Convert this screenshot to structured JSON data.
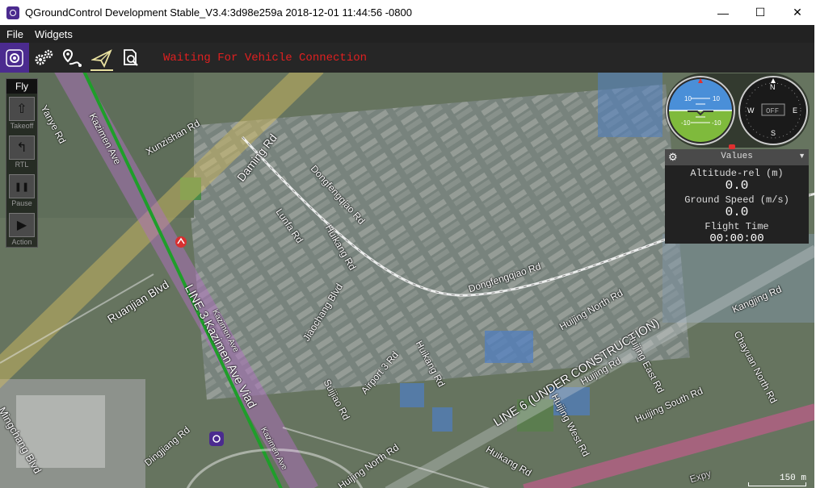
{
  "window": {
    "title": "QGroundControl Development Stable_V3.4:3d98e259a 2018-12-01 11:44:56 -0800",
    "controls": {
      "minimize": "—",
      "maximize": "☐",
      "close": "✕"
    }
  },
  "menu": {
    "items": [
      "File",
      "Widgets"
    ]
  },
  "toolbar": {
    "buttons": [
      "qgc-logo-icon",
      "settings-gears-icon",
      "plan-waypoint-icon",
      "fly-paper-plane-icon",
      "analyze-icon"
    ],
    "status": "Waiting For Vehicle Connection"
  },
  "fly_tools": {
    "title": "Fly",
    "items": [
      {
        "label": "Takeoff",
        "icon": "takeoff-icon",
        "glyph": "⇧"
      },
      {
        "label": "RTL",
        "icon": "rtl-icon",
        "glyph": "↰"
      },
      {
        "label": "Pause",
        "icon": "pause-icon",
        "glyph": "❚❚"
      },
      {
        "label": "Action",
        "icon": "action-icon",
        "glyph": "▶"
      }
    ]
  },
  "attitude": {
    "pitch_marks": [
      "10",
      "10",
      "-10",
      "-10"
    ]
  },
  "compass": {
    "n": "N",
    "e": "E",
    "s": "S",
    "w": "W",
    "status": "OFF"
  },
  "values": {
    "title": "Values",
    "altitude_label": "Altitude-rel (m)",
    "altitude_value": "0.0",
    "speed_label": "Ground Speed (m/s)",
    "speed_value": "0.0",
    "time_label": "Flight Time",
    "time_value": "00:00:00"
  },
  "map": {
    "roads": {
      "yanye": "Yanye Rd",
      "kazimen": "Kazimen Ave",
      "xunzishan": "Xunzishan Rd",
      "daming": "Daming Rd",
      "dongfengqiao1": "Dongfengqiao Rd",
      "dongfengqiao2": "Dongfengqiao Rd",
      "lunfa": "Lunfa Rd",
      "huikang1": "Huikang Rd",
      "ruanjian": "Ruanjian Blvd",
      "line3": "LINE 3 Kazimen Ave Viad",
      "kazimen2": "Kazimen Ave",
      "kazimen3": "Kazimen Ave",
      "jiaochang": "Jiaochang Blvd",
      "airport3": "Airport 3 Rd",
      "huikang2": "Huikang Rd",
      "suijiao": "Suijiao Rd",
      "mingchang": "Mingchang Blvd",
      "dingjiang": "Dingjiang Rd",
      "huijing_north1": "Huijing North Rd",
      "huijing_north2": "Huijing North Rd",
      "line6": "LINE 6 (UNDER CONSTRUCTION)",
      "huijing": "Huijing Rd",
      "huijing_west": "Huijing West Rd",
      "huijing_east": "Huijing East Rd",
      "huijing_south": "Huijing South Rd",
      "kangjing": "Kangjing Rd",
      "chayuan_north": "Chayuan North Rd",
      "huikang3": "Huikang Rd",
      "expy": "Expy"
    },
    "scale": "150 m"
  }
}
